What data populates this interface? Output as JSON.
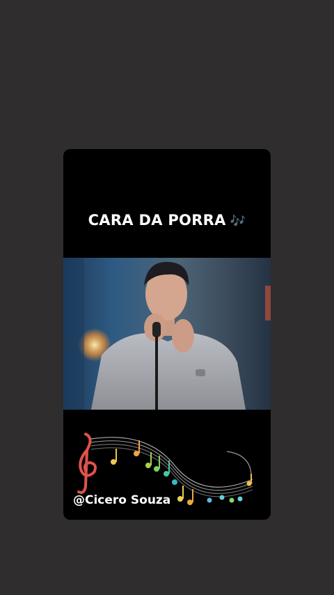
{
  "story": {
    "caption": "CARA DA PORRA",
    "caption_emoji": "🎶",
    "handle": "@Cicero Souza"
  },
  "colors": {
    "background": "#2f2d2d",
    "card": "#000000",
    "text": "#ffffff"
  }
}
